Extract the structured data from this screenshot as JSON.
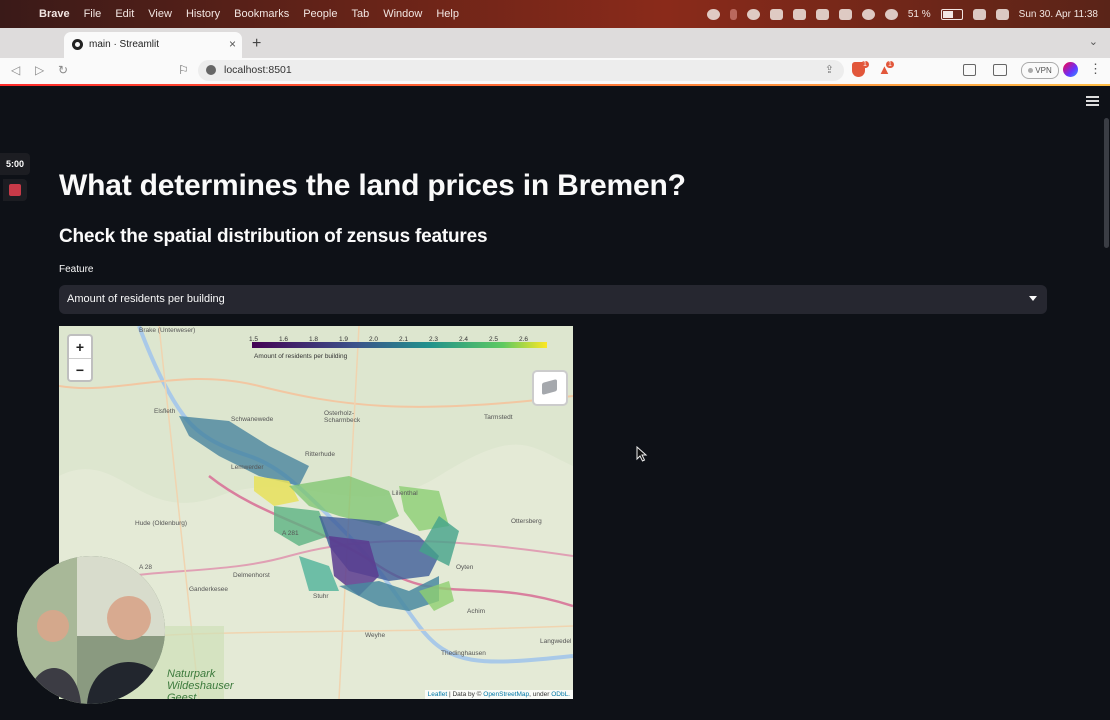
{
  "menubar": {
    "app_name": "Brave",
    "items": [
      "File",
      "Edit",
      "View",
      "History",
      "Bookmarks",
      "People",
      "Tab",
      "Window",
      "Help"
    ],
    "battery": "51 %",
    "datetime": "Sun 30. Apr  11:38"
  },
  "browser": {
    "tab_title": "main · Streamlit",
    "url": "localhost:8501",
    "vpn_label": "VPN",
    "shield_badge": "1",
    "rewards_badge": "1"
  },
  "app": {
    "title": "What determines the land prices in Bremen?",
    "subtitle": "Check the spatial distribution of zensus features",
    "feature_label": "Feature",
    "feature_value": "Amount of residents per building"
  },
  "recorder": {
    "timer": "5:00"
  },
  "map": {
    "legend": {
      "title": "Amount of residents per building",
      "ticks": [
        "1.5",
        "1.6",
        "1.8",
        "1.9",
        "2.0",
        "2.1",
        "2.3",
        "2.4",
        "2.5",
        "2.6"
      ]
    },
    "zoom_in": "+",
    "zoom_out": "−",
    "places": [
      {
        "name": "Brake (Unterweser)"
      },
      {
        "name": "Elsfleth"
      },
      {
        "name": "Schwanewede"
      },
      {
        "name": "Osterholz-Scharmbeck"
      },
      {
        "name": "Lilienthal"
      },
      {
        "name": "Tarmstedt"
      },
      {
        "name": "Ritterhude"
      },
      {
        "name": "Lemwerder"
      },
      {
        "name": "Ottersberg"
      },
      {
        "name": "Hude (Oldenburg)"
      },
      {
        "name": "Delmenhorst"
      },
      {
        "name": "Ganderkesee"
      },
      {
        "name": "Oyten"
      },
      {
        "name": "Stuhr"
      },
      {
        "name": "Achim"
      },
      {
        "name": "Weyhe"
      },
      {
        "name": "Langwedel"
      },
      {
        "name": "Thedinghausen"
      },
      {
        "name": "A 28"
      },
      {
        "name": "A 281"
      },
      {
        "name": "Naturpark Wildeshauser Geest"
      }
    ],
    "attribution": {
      "leaflet": "Leaflet",
      "middle": " | Data by © ",
      "osm": "OpenStreetMap",
      "under": ", under ",
      "odbl": "ODbL."
    }
  },
  "colors": {
    "background": "#0e1117",
    "select_bg": "#262730",
    "accent": "#ff4b4b"
  }
}
